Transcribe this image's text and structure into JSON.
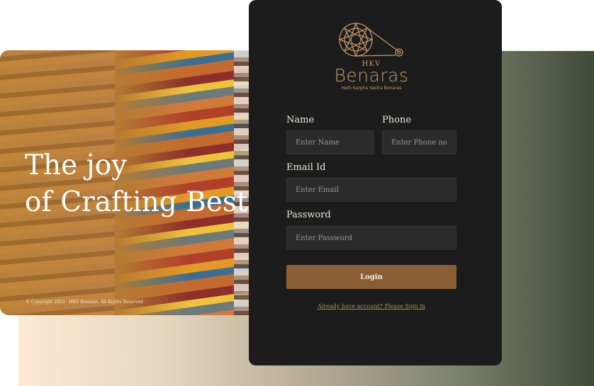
{
  "hero": {
    "title_line1": "The joy",
    "title_line2": "of Crafting Best",
    "copyright": "© Copyright 2023 · HKV Benaras. All Rights Reserved"
  },
  "brand": {
    "small": "HKV",
    "name": "Benaras",
    "tagline": "Hath Kargha Vastra Benaras",
    "logo_color": "#c99a66"
  },
  "form": {
    "name_label": "Name",
    "name_placeholder": "Enter Name",
    "phone_label": "Phone",
    "phone_placeholder": "Enter Phone no",
    "email_label": "Email Id",
    "email_placeholder": "Enter Email",
    "password_label": "Password",
    "password_placeholder": "Enter Password",
    "login_label": "Login",
    "signin_link": "Already have account? Please Sign in"
  },
  "colors": {
    "panel_bg": "#1c1c1c",
    "accent": "#8a5e35",
    "link": "#b58a55"
  }
}
